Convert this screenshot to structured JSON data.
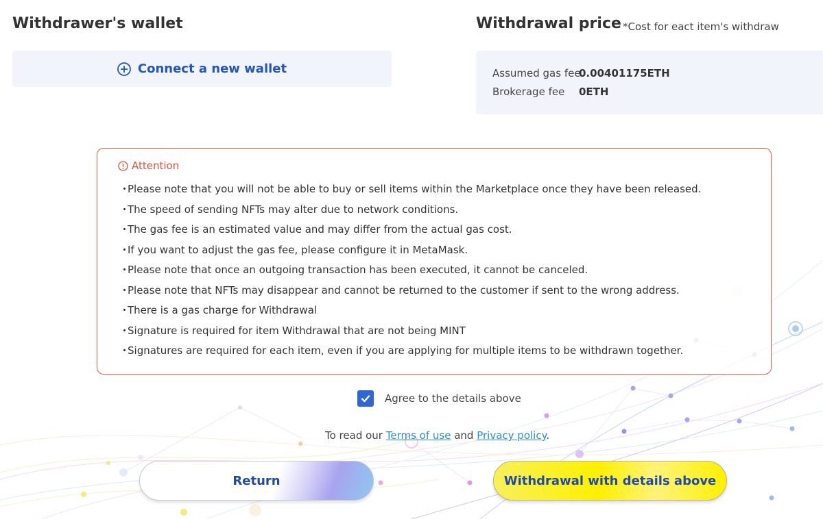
{
  "wallet": {
    "title": "Withdrawer's wallet",
    "connect_label": "Connect a new wallet",
    "connect_icon": "plus-circle-icon"
  },
  "price": {
    "title": "Withdrawal price",
    "note": "*Cost for eact item's withdraw",
    "gas_label": "Assumed gas fee",
    "gas_value": "0.00401175ETH",
    "brokerage_label": "Brokerage fee",
    "brokerage_value": "0ETH"
  },
  "attention": {
    "heading": "Attention",
    "icon": "info-circle-icon",
    "bullet": "・",
    "items": [
      "Please note that you will not be able to buy or sell items within the Marketplace once they have been released.",
      "The speed of sending NFTs may alter due to network conditions.",
      "The gas fee is an estimated value and may differ from the actual gas cost.",
      "If you want to adjust the gas fee, please configure it in MetaMask.",
      "Please note that once an outgoing transaction has been executed, it cannot be canceled.",
      "Please note that NFTs may disappear and cannot be returned to the customer if sent to the wrong address.",
      "There is a gas charge for Withdrawal",
      "Signature is required for item Withdrawal that are not being MINT",
      "Signatures are required for each item, even if you are applying for multiple items to be withdrawn together."
    ]
  },
  "agreement": {
    "label": "Agree to the details above",
    "checked": true
  },
  "terms": {
    "prefix": "To read our ",
    "terms_link": "Terms of use",
    "and": " and ",
    "privacy_link": "Privacy policy",
    "suffix": "."
  },
  "buttons": {
    "return_label": "Return",
    "withdraw_label": "Withdrawal with details above"
  },
  "colors": {
    "accent_blue": "#2355c4",
    "attention_red": "#e95a4e",
    "checkbox_blue": "#2f66d6",
    "withdraw_yellow": "#fff000",
    "panel_bg": "#f1f5fb"
  }
}
